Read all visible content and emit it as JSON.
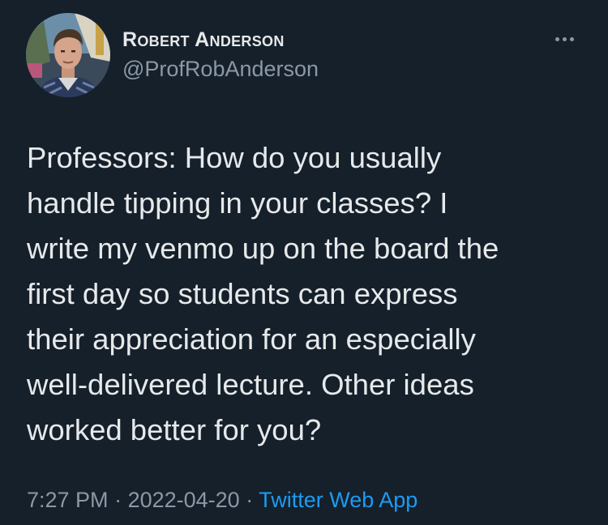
{
  "author": {
    "display_name": "Robert Anderson",
    "handle": "@ProfRobAnderson"
  },
  "tweet": {
    "text": "Professors: How do you usually\nhandle tipping in your classes? I\nwrite my venmo up on the board the\nfirst day so students can express\ntheir appreciation for an especially\nwell-delivered lecture. Other ideas\nworked better for you?",
    "time": "7:27 PM",
    "date": "2022-04-20",
    "separator": " · ",
    "source_app": "Twitter Web App"
  },
  "icons": {
    "more": "more-options-icon",
    "avatar": "profile-avatar"
  },
  "colors": {
    "background": "#15202b",
    "primary_text": "#e7e9ea",
    "secondary_text": "#8b98a5",
    "link": "#1d9bf0"
  }
}
